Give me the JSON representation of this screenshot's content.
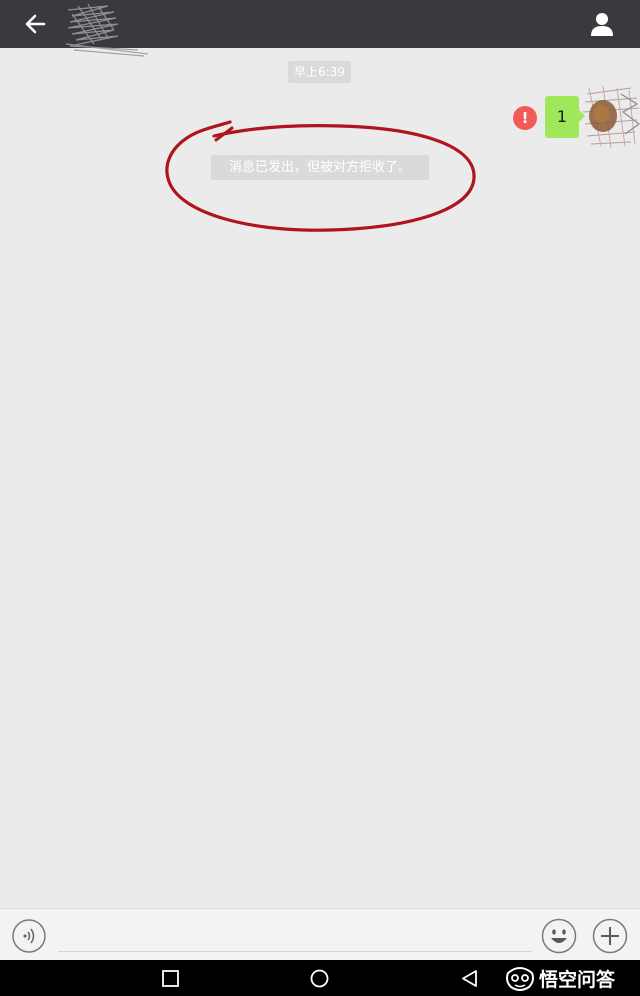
{
  "header": {
    "back_icon": "arrow-left-icon",
    "contact_name_redacted": true,
    "profile_icon": "person-icon",
    "bg_color": "#393a3f"
  },
  "chat": {
    "timestamp": "早上6:39",
    "outgoing_message": {
      "text": "1",
      "status_icon": "exclamation-error-icon",
      "bubble_color": "#a0e75a"
    },
    "system_notice": "消息已发出，但被对方拒收了。",
    "annotation_color": "#b0141c"
  },
  "input_bar": {
    "voice_icon": "voice-icon",
    "emoji_icon": "smiley-icon",
    "more_icon": "plus-circle-icon"
  },
  "nav_bar": {
    "recent_icon": "square-icon",
    "home_icon": "circle-icon",
    "back_icon": "triangle-back-icon"
  },
  "watermark": {
    "text": "悟空问答"
  }
}
